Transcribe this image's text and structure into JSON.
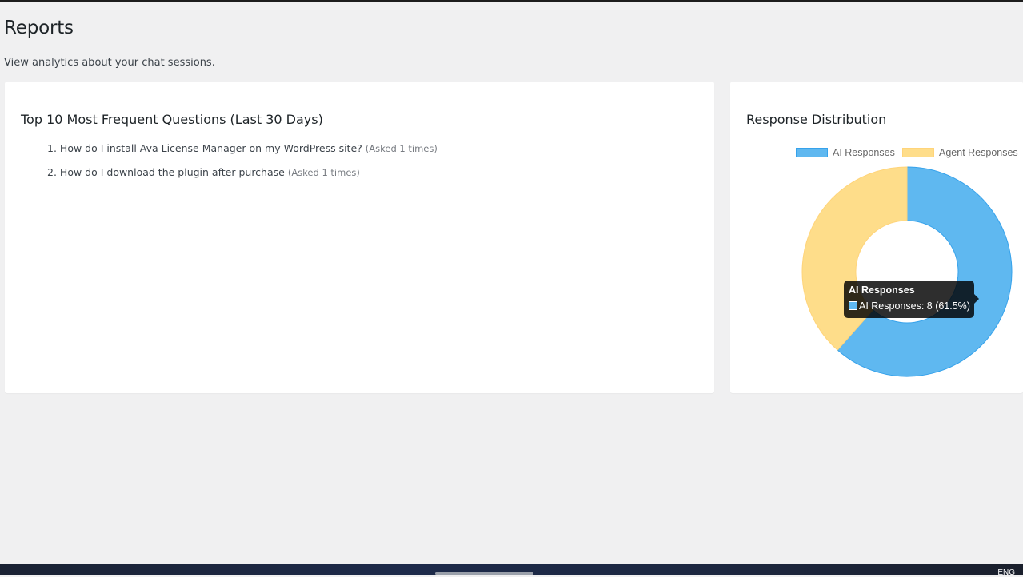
{
  "page": {
    "title": "Reports",
    "subtitle": "View analytics about your chat sessions."
  },
  "questions_card": {
    "title": "Top 10 Most Frequent Questions (Last 30 Days)",
    "items": [
      {
        "number": "1.",
        "text": "How do I install Ava License Manager on my WordPress site?",
        "count": "(Asked 1 times)"
      },
      {
        "number": "2.",
        "text": "How do I download the plugin after purchase",
        "count": "(Asked 1 times)"
      }
    ]
  },
  "chart_card": {
    "title": "Response Distribution"
  },
  "chart_data": {
    "type": "pie",
    "subtype": "doughnut",
    "labels": [
      "AI Responses",
      "Agent Responses"
    ],
    "values": [
      8,
      5
    ],
    "colors": [
      "#5fb8f0",
      "#fedd8a"
    ],
    "border_colors": [
      "#36a2eb",
      "#ffd47a"
    ],
    "legend": "top",
    "tooltip": {
      "title": "AI Responses",
      "body": "AI Responses: 8 (61.5%)"
    }
  },
  "taskbar": {
    "language": "ENG"
  }
}
